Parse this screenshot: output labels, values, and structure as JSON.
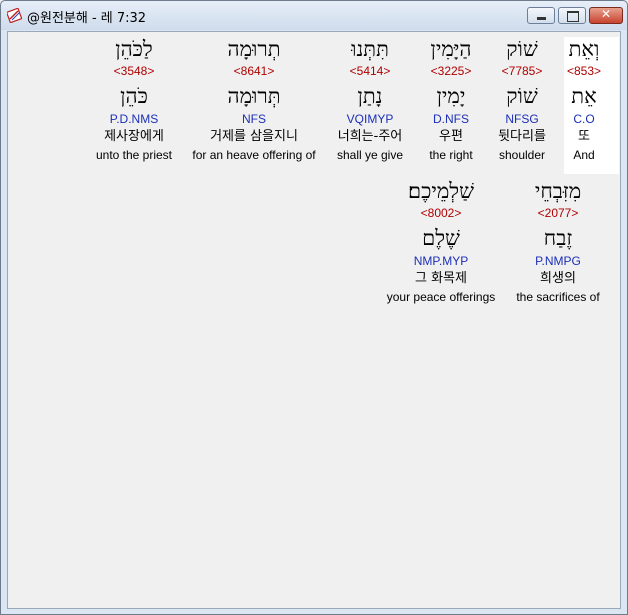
{
  "window": {
    "title": "@원전분해 - 레 7:32",
    "controls": {
      "minimize": "minimize",
      "maximize": "maximize",
      "close": "✕"
    }
  },
  "words_row1": [
    {
      "hebrew": "וְאֵת",
      "strong": "<853>",
      "lemma": "אֵת",
      "parse": "C.O",
      "korean": "또",
      "english": "And"
    },
    {
      "hebrew": "שׁוֹק",
      "strong": "<7785>",
      "lemma": "שׁוֹק",
      "parse": "NFSG",
      "korean": "뒷다리를",
      "english": "shoulder"
    },
    {
      "hebrew": "הַיָּמִין",
      "strong": "<3225>",
      "lemma": "יָמִין",
      "parse": "D.NFS",
      "korean": "우편",
      "english": "the right"
    },
    {
      "hebrew": "תִּתְּנוּ",
      "strong": "<5414>",
      "lemma": "נָתַן",
      "parse": "VQIMYP",
      "korean": "너희는-주어",
      "english": "shall ye give"
    },
    {
      "hebrew": "תְרוּמָה",
      "strong": "<8641>",
      "lemma": "תְּרוּמָה",
      "parse": "NFS",
      "korean": "거제를 삼을지니",
      "english": "for an heave offering of"
    },
    {
      "hebrew": "לַכֹּהֵן",
      "strong": "<3548>",
      "lemma": "כֹּהֵן",
      "parse": "P.D.NMS",
      "korean": "제사장에게",
      "english": "unto the priest"
    }
  ],
  "words_row2": [
    {
      "hebrew": "מִזִּבְחֵי",
      "strong": "<2077>",
      "lemma": "זֶבַח",
      "parse": "P.NMPG",
      "korean": "희생의",
      "english": "the sacrifices of"
    },
    {
      "hebrew": "שַׁלְמֵיכֶם׃",
      "strong": "<8002>",
      "lemma": "שֶׁלֶם",
      "parse": "NMP.MYP",
      "korean": "그 화목제",
      "english": "your peace offerings"
    }
  ]
}
